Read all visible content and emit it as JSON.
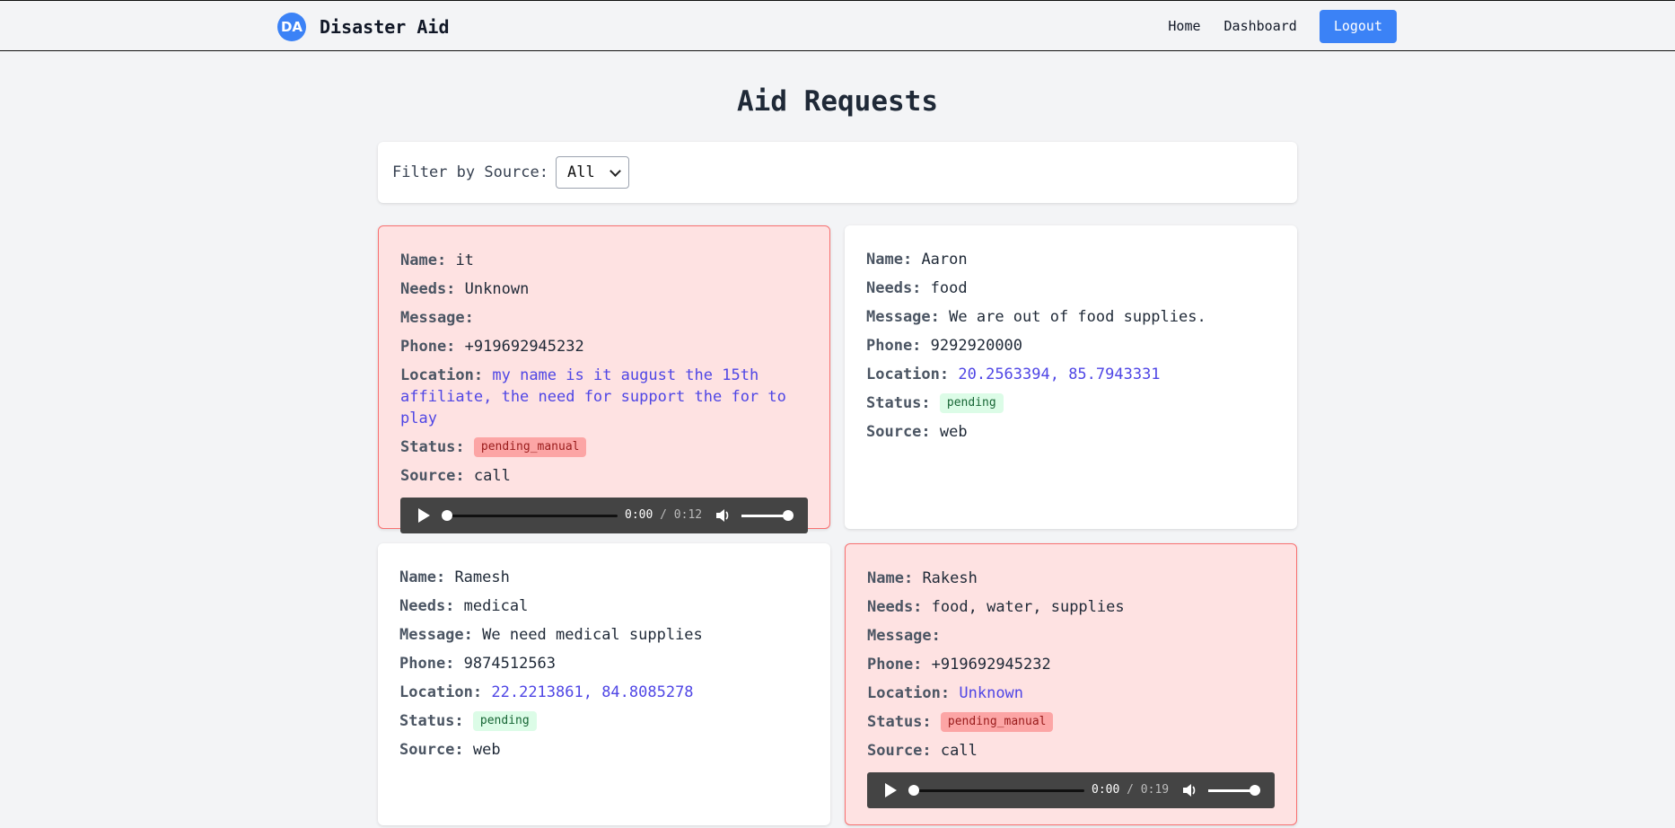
{
  "header": {
    "logo_initials": "DA",
    "app_name": "Disaster Aid",
    "nav": {
      "home": "Home",
      "dashboard": "Dashboard",
      "logout": "Logout"
    }
  },
  "page_title": "Aid Requests",
  "filter": {
    "label": "Filter by Source:",
    "selected": "All"
  },
  "field_labels": {
    "name": "Name:",
    "needs": "Needs:",
    "message": "Message:",
    "phone": "Phone:",
    "location": "Location:",
    "status": "Status:",
    "source": "Source:"
  },
  "requests": [
    {
      "name": "it",
      "needs": "Unknown",
      "message": "",
      "phone": "+919692945232",
      "location": "my name is it august the 15th affiliate, the need for support the for to play",
      "status": "pending_manual",
      "source": "call",
      "audio": {
        "current": "0:00",
        "duration": "/ 0:12"
      }
    },
    {
      "name": "Aaron",
      "needs": "food",
      "message": "We are out of food supplies.",
      "phone": "9292920000",
      "location": "20.2563394, 85.7943331",
      "status": "pending",
      "source": "web"
    },
    {
      "name": "Ramesh",
      "needs": "medical",
      "message": "We need medical supplies",
      "phone": "9874512563",
      "location": "22.2213861, 84.8085278",
      "status": "pending",
      "source": "web"
    },
    {
      "name": "Rakesh",
      "needs": "food, water, supplies",
      "message": "",
      "phone": "+919692945232",
      "location": "Unknown",
      "status": "pending_manual",
      "source": "call",
      "audio": {
        "current": "0:00",
        "duration": "/ 0:19"
      }
    }
  ],
  "colors": {
    "accent": "#3b82f6",
    "alert_bg": "#fee2e2",
    "alert_border": "#f87171",
    "location": "#4f46e5"
  }
}
